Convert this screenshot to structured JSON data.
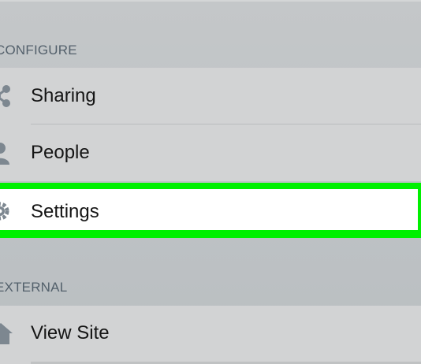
{
  "sections": {
    "configure_header": "CONFIGURE",
    "external_header": "EXTERNAL"
  },
  "menu": {
    "sharing": {
      "label": "Sharing",
      "icon": "share-icon"
    },
    "people": {
      "label": "People",
      "icon": "person-icon"
    },
    "settings": {
      "label": "Settings",
      "icon": "gear-icon",
      "highlighted": true
    },
    "view_site": {
      "label": "View Site",
      "icon": "home-icon"
    }
  },
  "colors": {
    "background": "#bfc3c6",
    "row": "#d2d3d4",
    "highlight_border": "#00f000",
    "section_text": "#53606b",
    "icon": "#7d8790"
  }
}
